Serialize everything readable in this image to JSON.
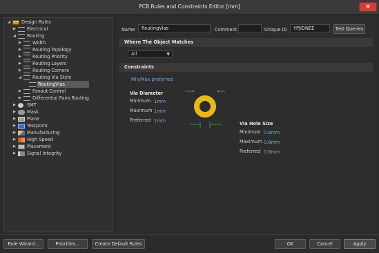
{
  "window": {
    "title": "PCB Rules and Constraints Editor [mm]",
    "close_glyph": "✕"
  },
  "tree": [
    {
      "label": "Design Rules",
      "arrow": "◢",
      "icon": "rules-folder-icon",
      "level": 0
    },
    {
      "label": "Electrical",
      "arrow": "▶",
      "icon": "electrical-icon",
      "level": 1
    },
    {
      "label": "Routing",
      "arrow": "◢",
      "icon": "routing-icon",
      "level": 1
    },
    {
      "label": "Width",
      "arrow": "▶",
      "icon": "width-icon",
      "level": 2
    },
    {
      "label": "Routing Topology",
      "arrow": "▶",
      "icon": "topology-icon",
      "level": 2
    },
    {
      "label": "Routing Priority",
      "arrow": "▶",
      "icon": "priority-icon",
      "level": 2
    },
    {
      "label": "Routing Layers",
      "arrow": "▶",
      "icon": "layers-icon",
      "level": 2
    },
    {
      "label": "Routing Corners",
      "arrow": "▶",
      "icon": "corners-icon",
      "level": 2
    },
    {
      "label": "Routing Via Style",
      "arrow": "◢",
      "icon": "via-style-icon",
      "level": 2
    },
    {
      "label": "RoutingVias",
      "arrow": "",
      "icon": "via-rule-icon",
      "level": 3,
      "selected": true
    },
    {
      "label": "Fanout Control",
      "arrow": "▶",
      "icon": "fanout-icon",
      "level": 2
    },
    {
      "label": "Differential Pairs Routing",
      "arrow": "▶",
      "icon": "diffpair-icon",
      "level": 2
    },
    {
      "label": "SMT",
      "arrow": "▶",
      "icon": "smt-icon",
      "level": 1
    },
    {
      "label": "Mask",
      "arrow": "▶",
      "icon": "mask-icon",
      "level": 1
    },
    {
      "label": "Plane",
      "arrow": "▶",
      "icon": "plane-icon",
      "level": 1
    },
    {
      "label": "Testpoint",
      "arrow": "▶",
      "icon": "testpoint-icon",
      "level": 1
    },
    {
      "label": "Manufacturing",
      "arrow": "▶",
      "icon": "manufacturing-icon",
      "level": 1
    },
    {
      "label": "High Speed",
      "arrow": "▶",
      "icon": "high-speed-icon",
      "level": 1
    },
    {
      "label": "Placement",
      "arrow": "▶",
      "icon": "placement-icon",
      "level": 1
    },
    {
      "label": "Signal Integrity",
      "arrow": "▶",
      "icon": "signal-integrity-icon",
      "level": 1
    }
  ],
  "header": {
    "name_label": "Name",
    "name_value": "RoutingVias",
    "comment_label": "Comment",
    "comment_value": "",
    "uid_label": "Unique ID",
    "uid_value": "YPJIDNEE",
    "test_queries": "Test Queries"
  },
  "where": {
    "title": "Where The Object Matches",
    "selected": "All"
  },
  "constraints": {
    "title": "Constraints",
    "note": "Min/Max preferred",
    "via_diameter": {
      "title": "Via Diameter",
      "minimum_label": "Minimum",
      "minimum": "1mm",
      "maximum_label": "Maximum",
      "maximum": "1mm",
      "preferred_label": "Preferred",
      "preferred": "1mm"
    },
    "via_hole": {
      "title": "Via Hole Size",
      "minimum_label": "Minimum",
      "minimum": "0.6mm",
      "maximum_label": "Maximum",
      "maximum": "0.6mm",
      "preferred_label": "Preferred",
      "preferred": "0.6mm"
    }
  },
  "footer": {
    "rule_wizard": "Rule Wizard...",
    "priorities": "Priorities...",
    "create_default": "Create Default Rules",
    "ok": "OK",
    "cancel": "Cancel",
    "apply": "Apply"
  },
  "colors": {
    "via_ring": "#e8b81f",
    "accent_text": "#7da7d9",
    "guide_lines": "#4aa55a"
  }
}
